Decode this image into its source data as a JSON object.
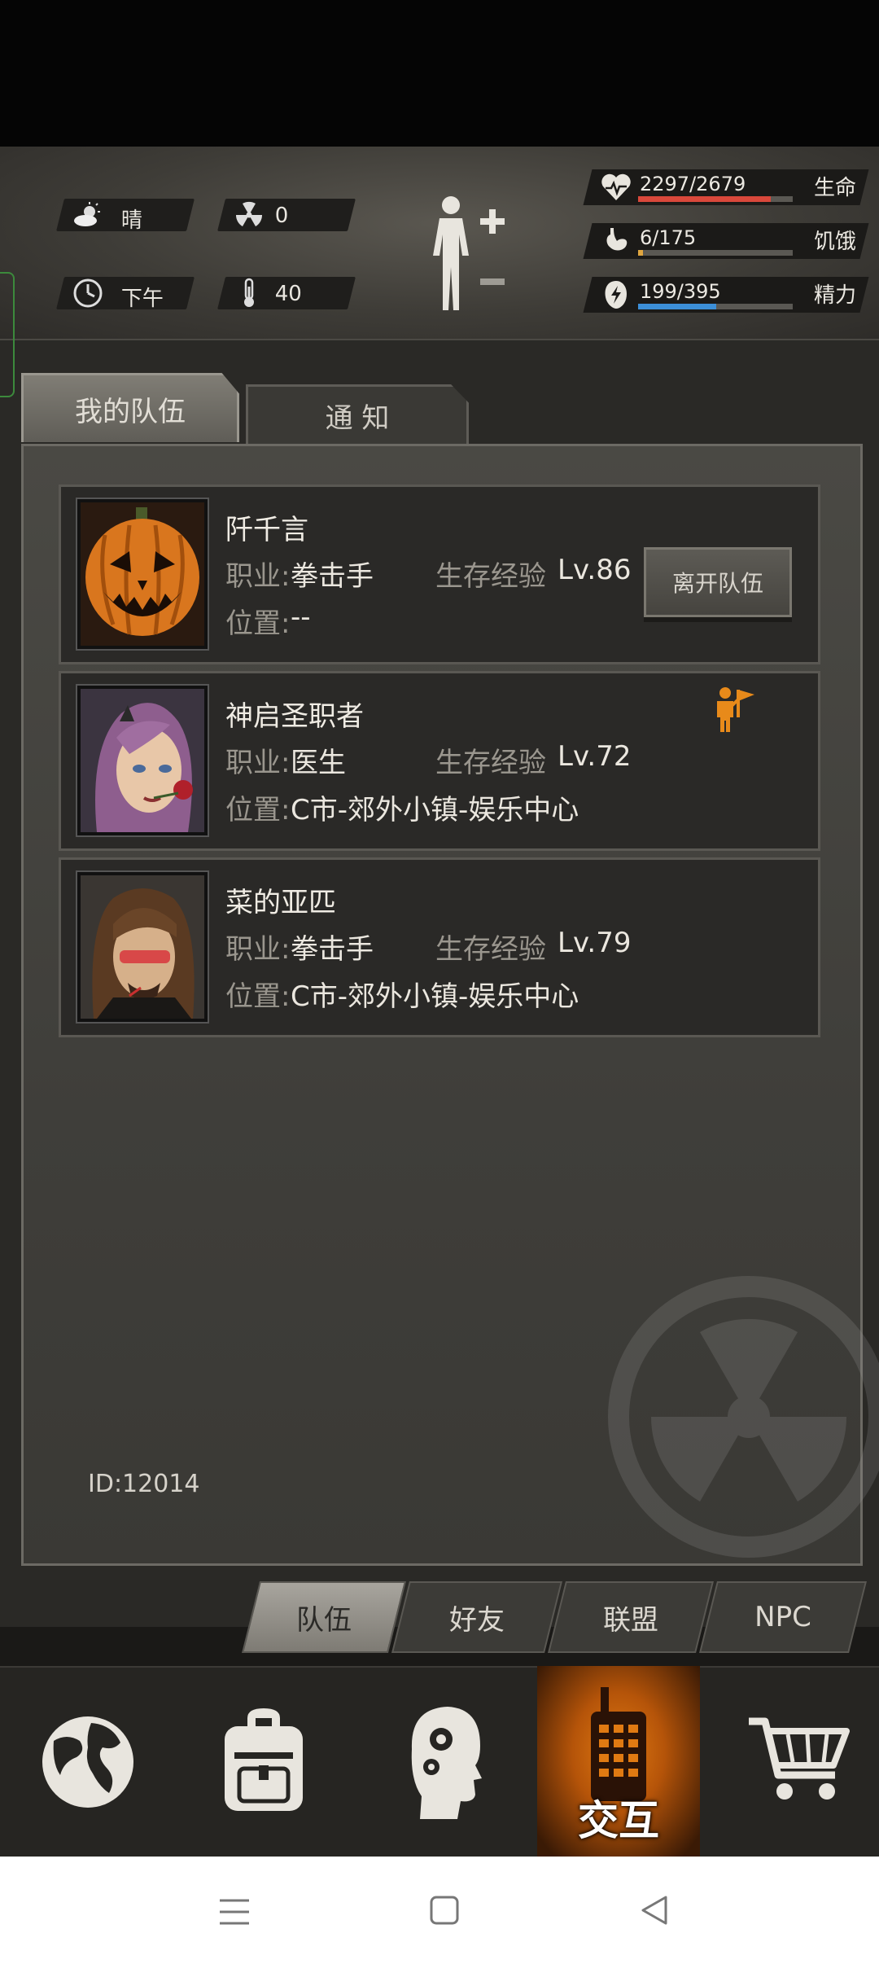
{
  "status": {
    "weather": "晴",
    "radiation": "0",
    "time_of_day": "下午",
    "temperature": "40",
    "health": {
      "value": "2297/2679",
      "label": "生命",
      "fraction": 0.857,
      "color": "#d9483b"
    },
    "hunger": {
      "value": "6/175",
      "label": "饥饿",
      "fraction": 0.034,
      "color": "#e0a640"
    },
    "energy": {
      "value": "199/395",
      "label": "精力",
      "fraction": 0.504,
      "color": "#3c8fd8"
    }
  },
  "tabs": {
    "my_team": "我的队伍",
    "notice": "通 知"
  },
  "labels": {
    "job": "职业:",
    "location": "位置:",
    "survival_exp": "生存经验"
  },
  "members": [
    {
      "name": "阡千言",
      "job": "拳击手",
      "level": "Lv.86",
      "location": "--",
      "action": "离开队伍"
    },
    {
      "name": "神启圣职者",
      "job": "医生",
      "level": "Lv.72",
      "location": "C市-郊外小镇-娱乐中心"
    },
    {
      "name": "菜的亚匹",
      "job": "拳击手",
      "level": "Lv.79",
      "location": "C市-郊外小镇-娱乐中心"
    }
  ],
  "player_id": "ID:12014",
  "subtabs": [
    "队伍",
    "好友",
    "联盟",
    "NPC"
  ],
  "bottom_nav": {
    "interact_label": "交互"
  },
  "icons": [
    "sun-cloud-icon",
    "radiation-icon",
    "clock-icon",
    "thermometer-icon",
    "body-icon",
    "heart-icon",
    "stomach-icon",
    "energy-icon",
    "leader-flag-icon",
    "globe-icon",
    "backpack-icon",
    "head-gear-icon",
    "walkie-talkie-icon",
    "cart-icon"
  ]
}
